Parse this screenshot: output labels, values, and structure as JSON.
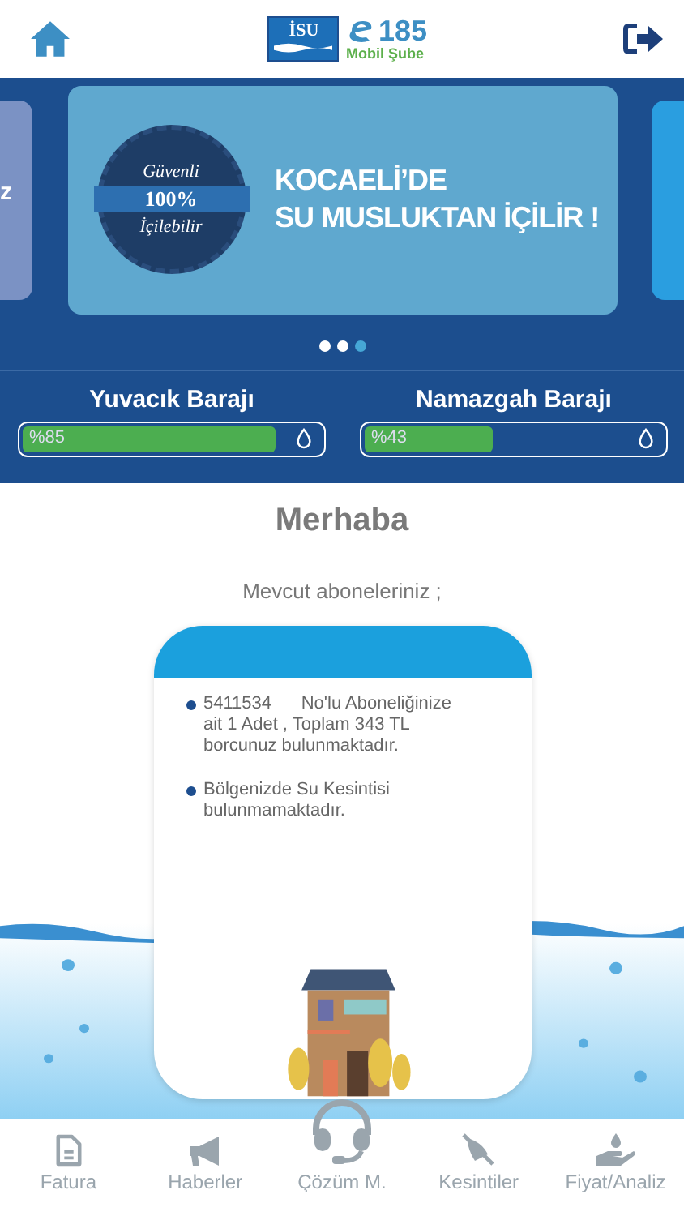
{
  "header": {
    "logo_left": "İSU",
    "logo_number": "185",
    "logo_subtitle": "Mobil Şube"
  },
  "carousel": {
    "badge": {
      "top": "Güvenli",
      "middle": "100%",
      "bottom": "İçilebilir"
    },
    "headline": [
      "KOCAELİ’DE",
      "SU MUSLUKTAN İÇİLİR !"
    ],
    "left_peek": "z",
    "dots": [
      {
        "selected": false
      },
      {
        "selected": false
      },
      {
        "selected": true
      }
    ]
  },
  "dams": [
    {
      "name": "Yuvacık Barajı",
      "reading": "%85",
      "level": 0.85
    },
    {
      "name": "Namazgah Barajı",
      "reading": "%43",
      "level": 0.43
    }
  ],
  "greeting": "Merhaba",
  "subscriptions_label": "Mevcut aboneleriniz ;",
  "card": {
    "items": [
      "5411534      No'lu Aboneliğinize ait 1 Adet , Toplam 343 TL  borcunuz bulunmaktadır.",
      "Bölgenizde Su Kesintisi bulunmamaktadır."
    ]
  },
  "nav": [
    {
      "label": "Fatura"
    },
    {
      "label": "Haberler"
    },
    {
      "label": "Çözüm M."
    },
    {
      "label": "Kesintiler"
    },
    {
      "label": "Fiyat/Analiz"
    }
  ]
}
